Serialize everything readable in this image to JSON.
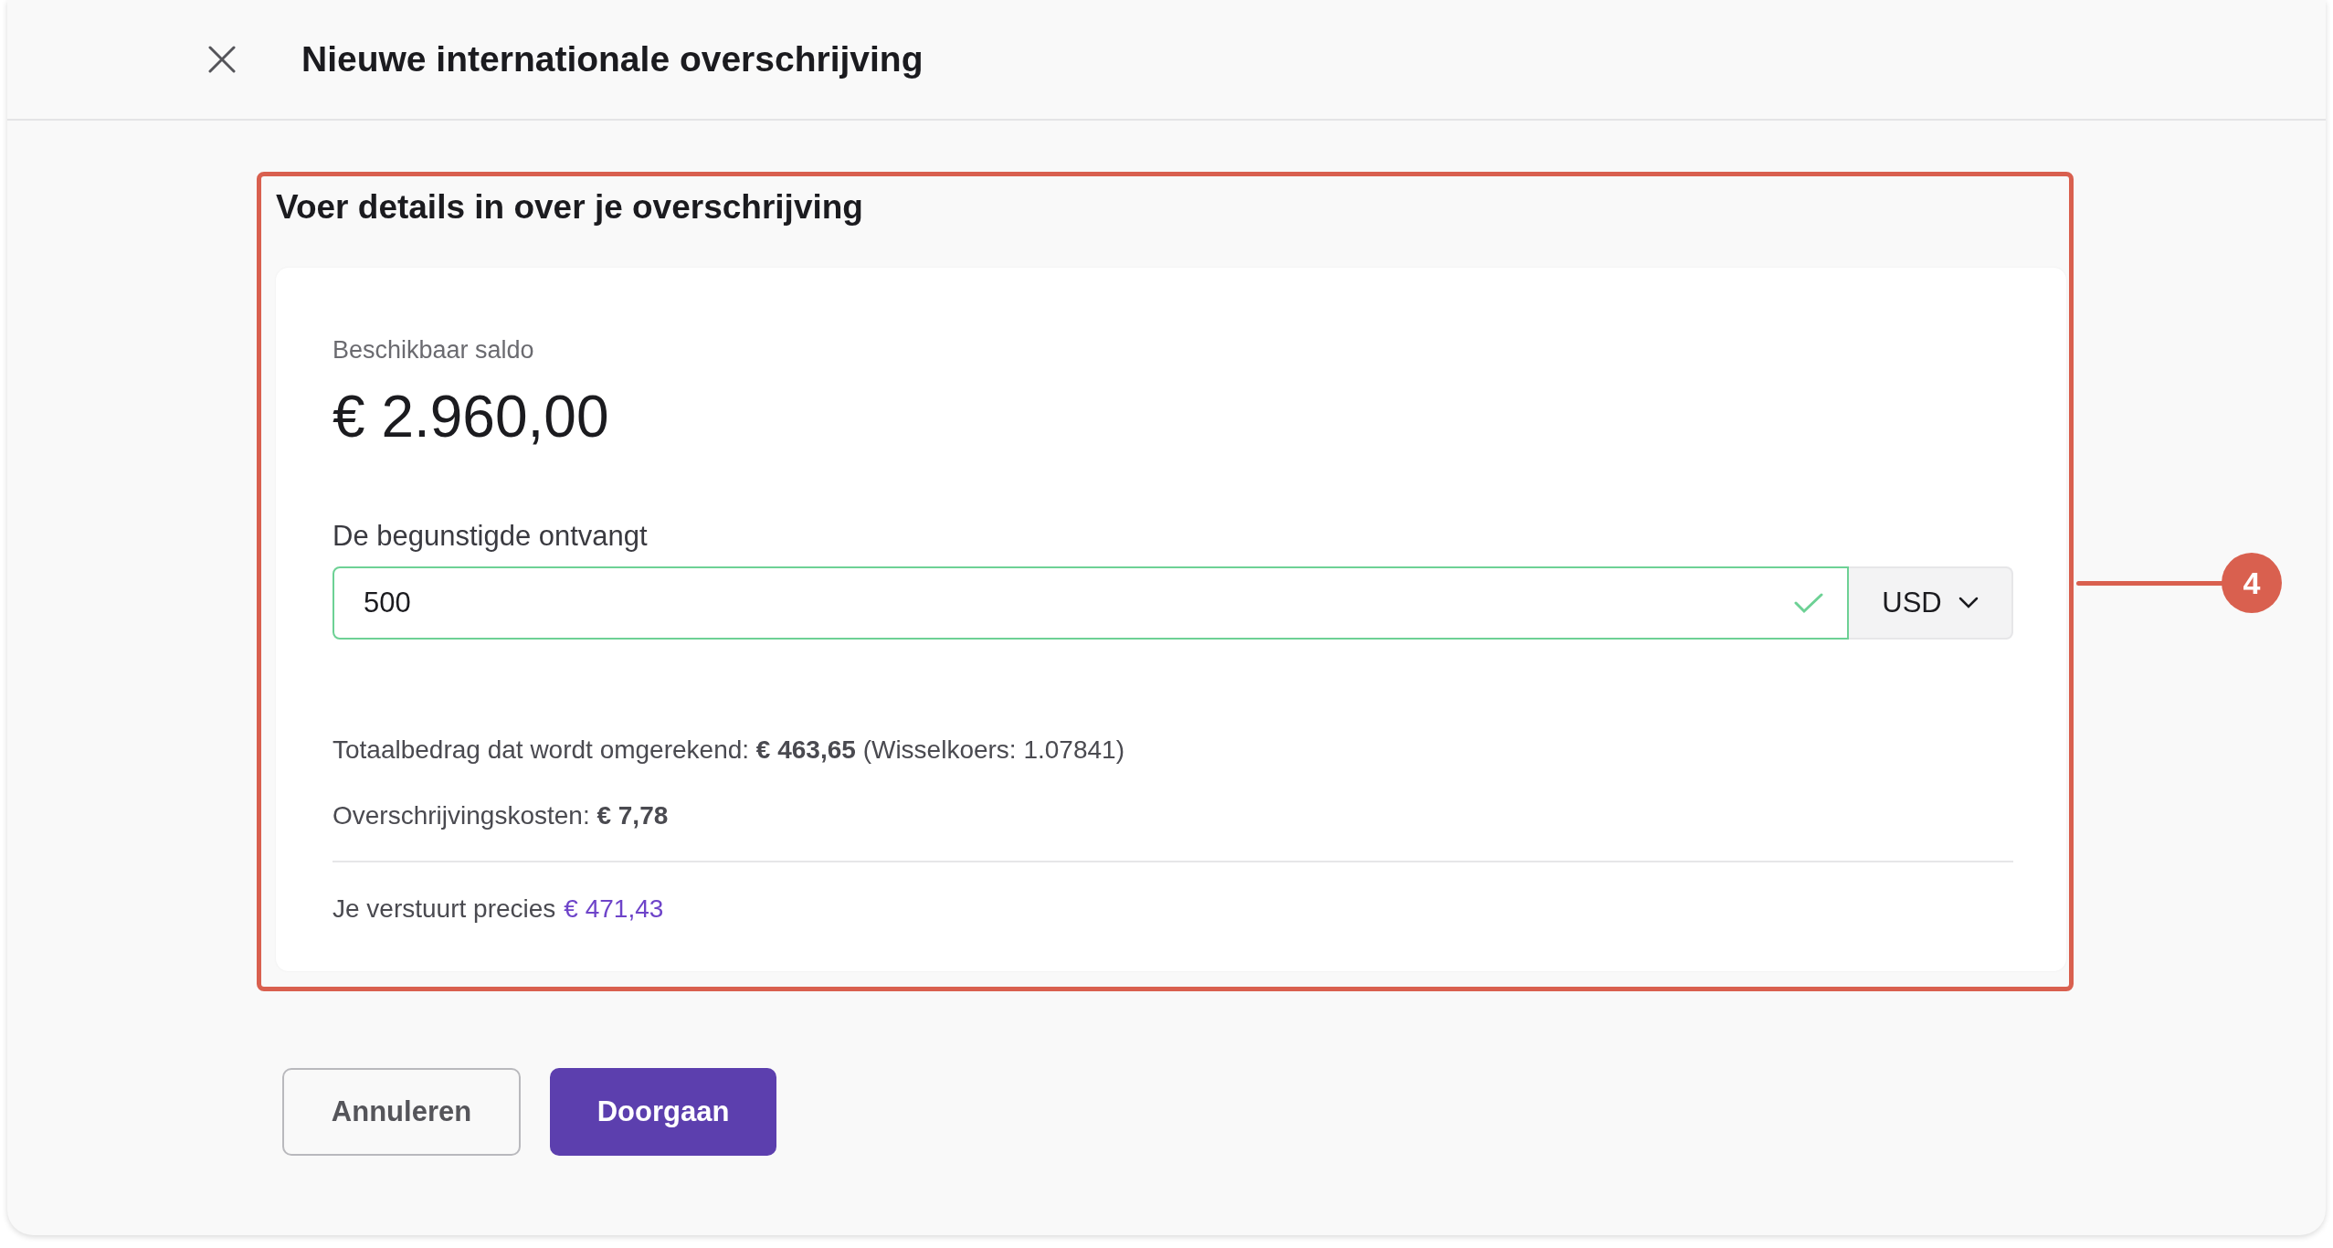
{
  "header": {
    "title": "Nieuwe internationale overschrijving"
  },
  "section": {
    "title": "Voer details in over je overschrijving",
    "balance": {
      "label": "Beschikbaar saldo",
      "amount": "€ 2.960,00"
    },
    "amount_field": {
      "label": "De begunstigde ontvangt",
      "value": "500",
      "valid": true,
      "currency": "USD"
    },
    "summary": [
      "Totaalbedrag dat wordt omgerekend: **€ 463,65** (Wisselkoers: 1.07841)",
      "Overschrijvingskosten: **€ 7,78**"
    ],
    "total": {
      "label": "Je verstuurt precies",
      "amount": "€ 471,43"
    }
  },
  "callout": {
    "label": "4"
  },
  "buttons": [
    {
      "label": "Annuleren",
      "kind": "secondary"
    },
    {
      "label": "Doorgaan",
      "kind": "primary"
    }
  ]
}
